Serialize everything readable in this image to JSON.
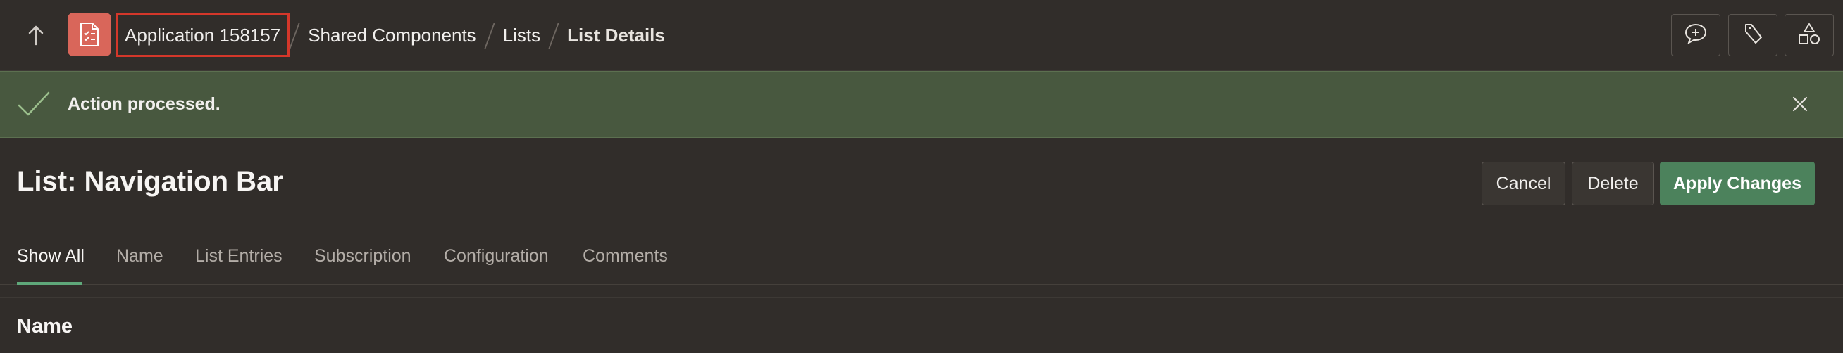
{
  "topbar": {
    "up_icon": "arrow-up-icon",
    "app_icon": "application-icon",
    "breadcrumbs": [
      "Application 158157",
      "Shared Components",
      "Lists",
      "List Details"
    ],
    "tools": [
      {
        "name": "feedback-icon"
      },
      {
        "name": "utilities-icon"
      },
      {
        "name": "shapes-icon"
      }
    ]
  },
  "alert": {
    "message": "Action processed.",
    "icon": "check-icon",
    "close_icon": "close-icon"
  },
  "header": {
    "title": "List: Navigation Bar",
    "buttons": {
      "cancel": "Cancel",
      "delete": "Delete",
      "apply": "Apply Changes"
    }
  },
  "tabs": [
    "Show All",
    "Name",
    "List Entries",
    "Subscription",
    "Configuration",
    "Comments"
  ],
  "section": {
    "title": "Name"
  },
  "colors": {
    "background": "#312d2a",
    "alert_bg": "#48583f",
    "primary": "#4c825c",
    "highlight_border": "#d4372a",
    "app_icon_bg": "#d9665a"
  }
}
